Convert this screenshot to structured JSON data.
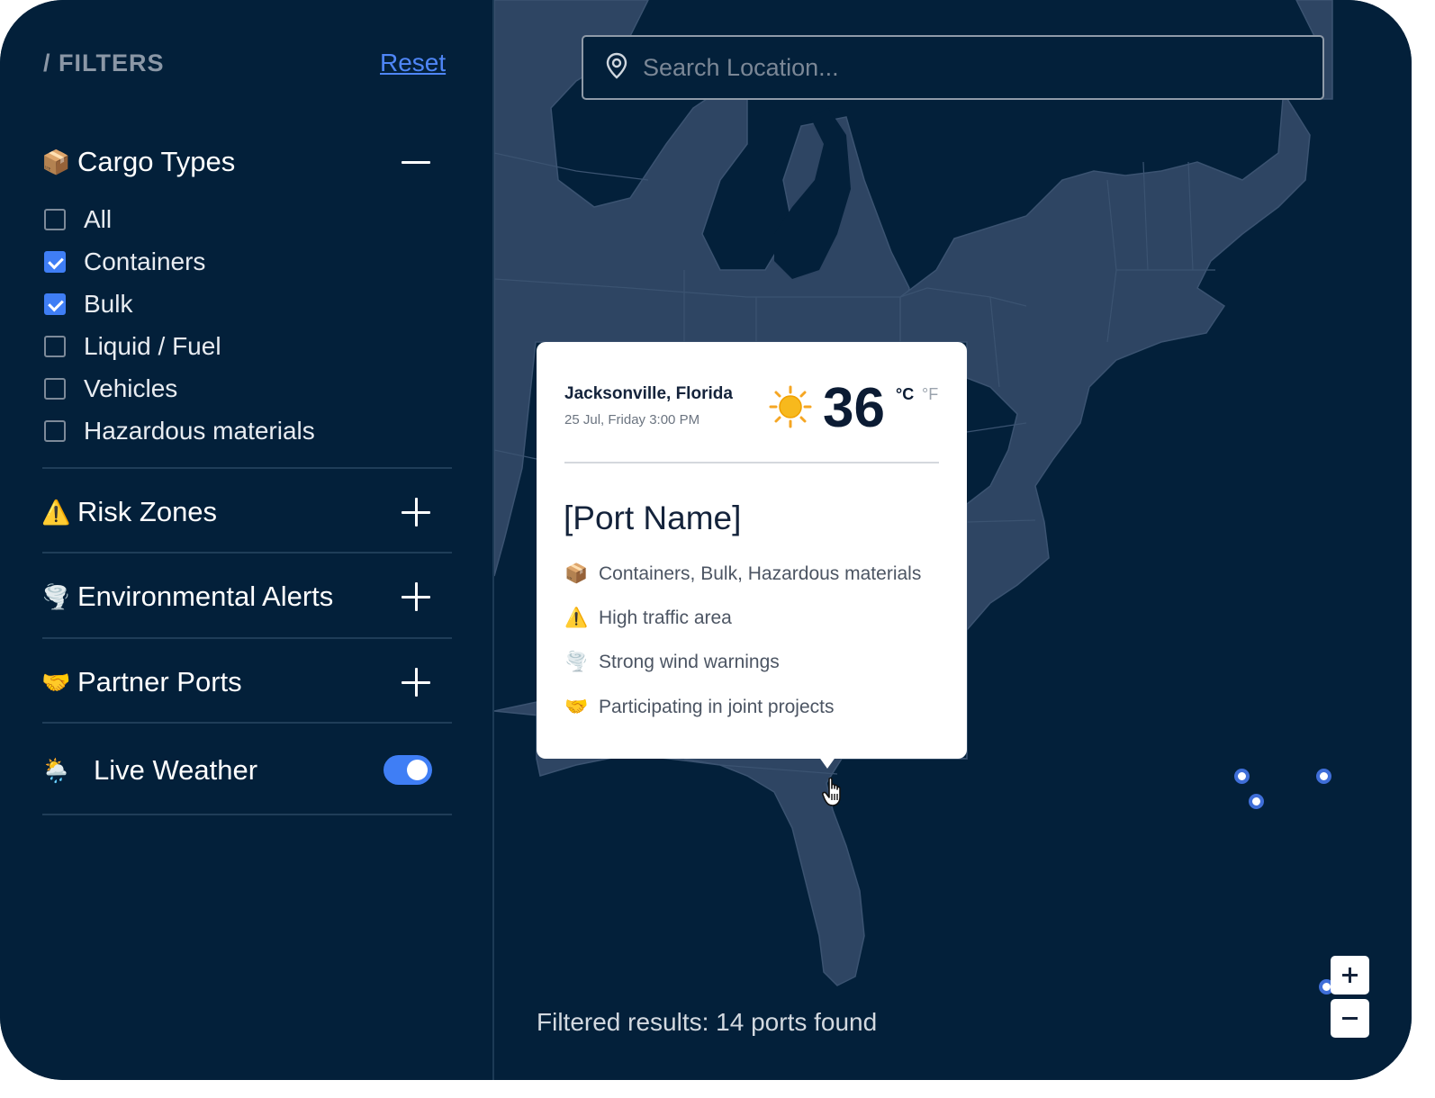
{
  "sidebar": {
    "title": "/ FILTERS",
    "reset_label": "Reset",
    "cargo": {
      "icon": "package-icon",
      "label": "Cargo Types",
      "expanded": true,
      "options": [
        {
          "label": "All",
          "checked": false
        },
        {
          "label": "Containers",
          "checked": true
        },
        {
          "label": "Bulk",
          "checked": true
        },
        {
          "label": "Liquid / Fuel",
          "checked": false
        },
        {
          "label": "Vehicles",
          "checked": false
        },
        {
          "label": "Hazardous materials",
          "checked": false
        }
      ]
    },
    "risk": {
      "icon": "warning-icon",
      "label": "Risk Zones"
    },
    "environment": {
      "icon": "tornado-icon",
      "label": "Environmental Alerts"
    },
    "partners": {
      "icon": "handshake-icon",
      "label": "Partner Ports"
    },
    "weather": {
      "icon": "cloud-sun-rain-icon",
      "label": "Live Weather",
      "enabled": true
    }
  },
  "map": {
    "search_placeholder": "Search Location...",
    "results_text": "Filtered results: 14 ports found",
    "popup": {
      "city": "Jacksonville, Florida",
      "date": "25 Jul, Friday 3:00 PM",
      "temperature": "36",
      "unit_c": "°C",
      "unit_f": "°F",
      "port_name": "[Port Name]",
      "details": [
        {
          "icon": "package-icon",
          "text": "Containers, Bulk, Hazardous materials"
        },
        {
          "icon": "warning-icon",
          "text": "High traffic area"
        },
        {
          "icon": "tornado-icon",
          "text": "Strong wind warnings"
        },
        {
          "icon": "handshake-icon",
          "text": "Participating in joint projects"
        }
      ]
    },
    "zoom_in": "+",
    "zoom_out": "−"
  },
  "colors": {
    "background": "#03203a",
    "land": "#2e4563",
    "accent": "#3f7ef5",
    "marker": "#3f6ed8"
  }
}
